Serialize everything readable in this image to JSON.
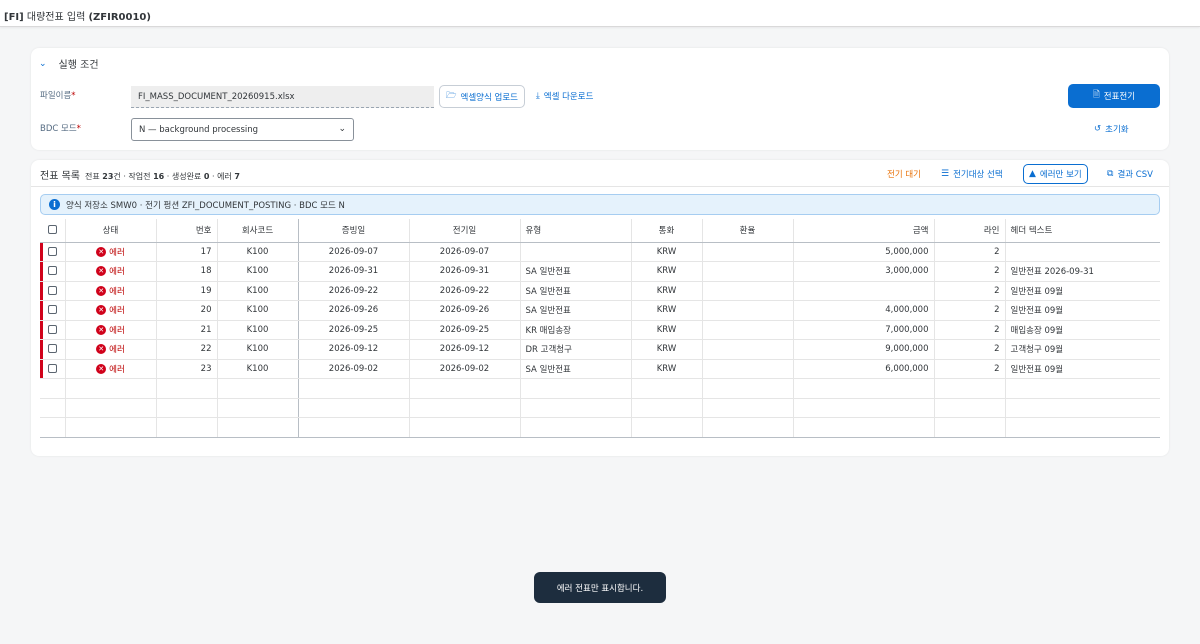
{
  "app": {
    "code": "[FI]",
    "title": "대량전표 입력",
    "tcode": "(ZFIR0010)"
  },
  "conditions": {
    "section_title": "실행 조건",
    "file_label": "파일이름",
    "file_value": "FI_MASS_DOCUMENT_20260915.xlsx",
    "upload_label": "엑셀양식 업로드",
    "download_label": "엑셀 다운로드",
    "post_label": "전표전기",
    "bdc_label": "BDC 모드",
    "bdc_value": "N — background processing",
    "reset_label": "초기화",
    "required_mark": "*"
  },
  "list": {
    "title": "전표 목록",
    "summary": {
      "total_label": "전표",
      "total": "23",
      "total_unit": "건",
      "work_label": "작업전",
      "work": "16",
      "done_label": "생성완료",
      "done": "0",
      "err_label": "에러",
      "err": "7",
      "dot": "·"
    },
    "tools": {
      "pending": "전기 대기",
      "select": "전기대상 선택",
      "errors_only": "에러만 보기",
      "csv": "결과 CSV"
    },
    "banner": "양식 저장소 SMW0 · 전기 펑션 ZFI_DOCUMENT_POSTING · BDC 모드 N",
    "columns": [
      "상태",
      "번호",
      "회사코드",
      "증빙일",
      "전기일",
      "유형",
      "통화",
      "환율",
      "금액",
      "라인",
      "헤더 텍스트"
    ],
    "rows": [
      {
        "status": "에러",
        "no": "17",
        "company": "K100",
        "doc_date": "2026-09-07",
        "post_date": "2026-09-07",
        "type": "",
        "currency": "KRW",
        "rate": "",
        "amount": "5,000,000",
        "lines": "2",
        "header_text": ""
      },
      {
        "status": "에러",
        "no": "18",
        "company": "K100",
        "doc_date": "2026-09-31",
        "post_date": "2026-09-31",
        "type": "SA 일반전표",
        "currency": "KRW",
        "rate": "",
        "amount": "3,000,000",
        "lines": "2",
        "header_text": "일반전표 2026-09-31"
      },
      {
        "status": "에러",
        "no": "19",
        "company": "K100",
        "doc_date": "2026-09-22",
        "post_date": "2026-09-22",
        "type": "SA 일반전표",
        "currency": "KRW",
        "rate": "",
        "amount": "",
        "lines": "2",
        "header_text": "일반전표 09월"
      },
      {
        "status": "에러",
        "no": "20",
        "company": "K100",
        "doc_date": "2026-09-26",
        "post_date": "2026-09-26",
        "type": "SA 일반전표",
        "currency": "KRW",
        "rate": "",
        "amount": "4,000,000",
        "lines": "2",
        "header_text": "일반전표 09월"
      },
      {
        "status": "에러",
        "no": "21",
        "company": "K100",
        "doc_date": "2026-09-25",
        "post_date": "2026-09-25",
        "type": "KR 매입송장",
        "currency": "KRW",
        "rate": "",
        "amount": "7,000,000",
        "lines": "2",
        "header_text": "매입송장 09월"
      },
      {
        "status": "에러",
        "no": "22",
        "company": "K100",
        "doc_date": "2026-09-12",
        "post_date": "2026-09-12",
        "type": "DR 고객청구",
        "currency": "KRW",
        "rate": "",
        "amount": "9,000,000",
        "lines": "2",
        "header_text": "고객청구 09월"
      },
      {
        "status": "에러",
        "no": "23",
        "company": "K100",
        "doc_date": "2026-09-02",
        "post_date": "2026-09-02",
        "type": "SA 일반전표",
        "currency": "KRW",
        "rate": "",
        "amount": "6,000,000",
        "lines": "2",
        "header_text": "일반전표 09월"
      }
    ]
  },
  "toast": "에러 전표만 표시합니다.",
  "colors": {
    "accent": "#0a6ed1",
    "error": "#d0021b",
    "warning": "#e9730c",
    "toast_bg": "#1d2d3e"
  }
}
